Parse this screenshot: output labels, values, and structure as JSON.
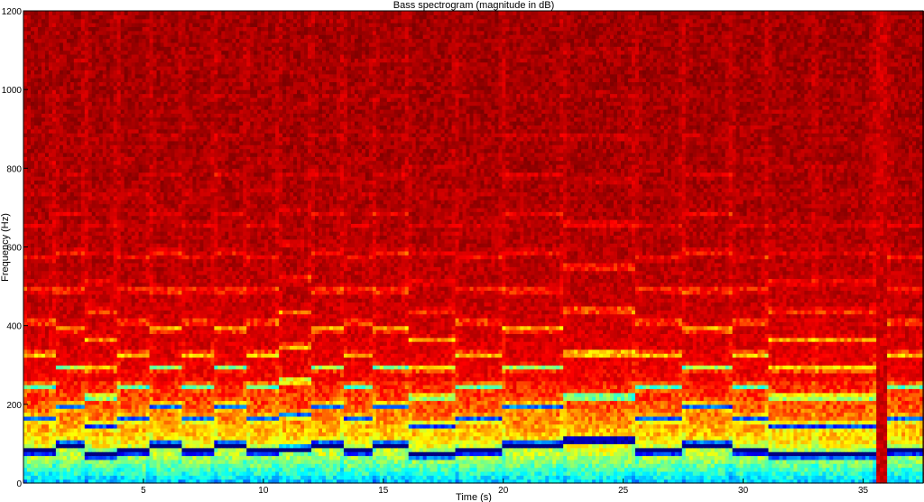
{
  "chart_data": {
    "type": "heatmap",
    "title": "Bass spectrogram (magnitude in dB)",
    "xlabel": "Time (s)",
    "ylabel": "Frequency (Hz)",
    "xlim": [
      0,
      37.5
    ],
    "ylim": [
      0,
      1200
    ],
    "x_ticks": [
      5,
      10,
      15,
      20,
      25,
      30,
      35
    ],
    "y_ticks": [
      0,
      200,
      400,
      600,
      800,
      1000,
      1200
    ],
    "colormap": [
      "#00007f",
      "#0000ff",
      "#00ffff",
      "#ffff00",
      "#ff0000",
      "#7f0000"
    ],
    "note_segments": [
      {
        "t0": 0.0,
        "t1": 1.3,
        "f0": 82
      },
      {
        "t0": 1.3,
        "t1": 2.6,
        "f0": 98
      },
      {
        "t0": 2.6,
        "t1": 3.9,
        "f0": 73
      },
      {
        "t0": 3.9,
        "t1": 5.3,
        "f0": 82
      },
      {
        "t0": 5.3,
        "t1": 6.6,
        "f0": 98
      },
      {
        "t0": 6.6,
        "t1": 8.0,
        "f0": 82
      },
      {
        "t0": 8.0,
        "t1": 9.3,
        "f0": 98
      },
      {
        "t0": 9.3,
        "t1": 10.6,
        "f0": 82
      },
      {
        "t0": 10.6,
        "t1": 12.0,
        "f0": 87
      },
      {
        "t0": 12.0,
        "t1": 13.3,
        "f0": 98
      },
      {
        "t0": 13.3,
        "t1": 14.6,
        "f0": 82
      },
      {
        "t0": 14.6,
        "t1": 16.0,
        "f0": 98
      },
      {
        "t0": 16.0,
        "t1": 18.0,
        "f0": 73
      },
      {
        "t0": 18.0,
        "t1": 20.0,
        "f0": 82
      },
      {
        "t0": 20.0,
        "t1": 22.5,
        "f0": 98
      },
      {
        "t0": 22.5,
        "t1": 25.5,
        "f0": 110
      },
      {
        "t0": 25.5,
        "t1": 27.5,
        "f0": 82
      },
      {
        "t0": 27.5,
        "t1": 29.5,
        "f0": 98
      },
      {
        "t0": 29.5,
        "t1": 31.0,
        "f0": 82
      },
      {
        "t0": 31.0,
        "t1": 33.0,
        "f0": 73
      },
      {
        "t0": 33.0,
        "t1": 35.5,
        "f0": 73
      },
      {
        "t0": 35.5,
        "t1": 36.0,
        "f0": 0
      },
      {
        "t0": 36.0,
        "t1": 37.5,
        "f0": 82
      }
    ]
  }
}
